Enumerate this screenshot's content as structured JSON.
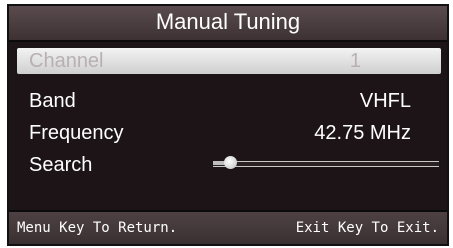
{
  "menu": {
    "title": "Manual Tuning",
    "items": [
      {
        "label": "Channel",
        "value": "1",
        "selected": true
      },
      {
        "label": "Band",
        "value": "VHFL"
      },
      {
        "label": "Frequency",
        "value": "42.75 MHz"
      },
      {
        "label": "Search",
        "search_progress": 0.03
      }
    ]
  },
  "footer": {
    "left_hint": "Menu Key To Return.",
    "right_hint": "Exit Key To Exit."
  }
}
